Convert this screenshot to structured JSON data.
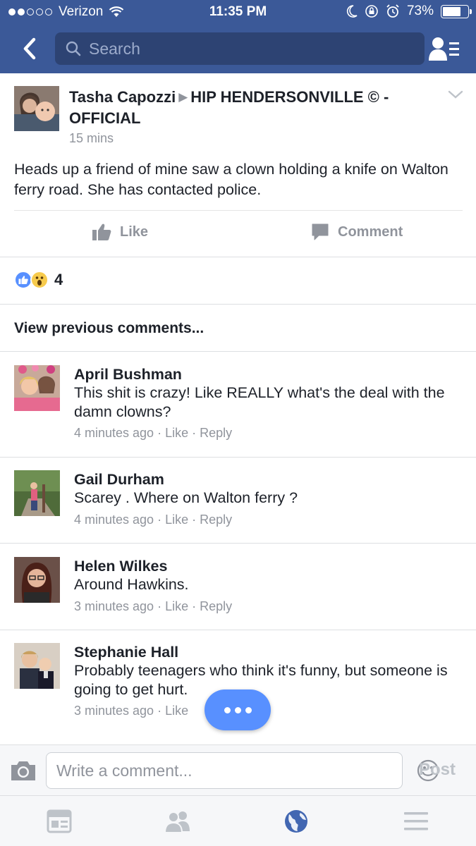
{
  "status_bar": {
    "carrier": "Verizon",
    "time": "11:35 PM",
    "battery": "73%",
    "battery_level": 0.73
  },
  "search": {
    "placeholder": "Search"
  },
  "post": {
    "author": "Tasha Capozzi",
    "group": "HIP HENDERSONVILLE © - OFFICIAL",
    "time": "15 mins",
    "text": "Heads up a friend of mine saw a clown holding a knife on Walton ferry road.  She has contacted police.",
    "like_label": "Like",
    "comment_label": "Comment",
    "reaction_count": "4"
  },
  "view_previous": "View previous comments...",
  "comments": [
    {
      "name": "April Bushman",
      "text": "This shit is crazy! Like REALLY what's the deal with the damn clowns?",
      "time": "4 minutes ago",
      "like": "Like",
      "reply": "Reply"
    },
    {
      "name": "Gail Durham",
      "text": "Scarey . Where on Walton ferry ?",
      "time": "4 minutes ago",
      "like": "Like",
      "reply": "Reply"
    },
    {
      "name": "Helen Wilkes",
      "text": "Around Hawkins.",
      "time": "3 minutes ago",
      "like": "Like",
      "reply": "Reply"
    },
    {
      "name": "Stephanie Hall",
      "text": "Probably teenagers who think it's funny, but someone is going to get hurt.",
      "time": "3 minutes ago",
      "like": "Like"
    }
  ],
  "composer": {
    "placeholder": "Write a comment...",
    "post_label": "Post"
  },
  "colors": {
    "brand": "#3b5998",
    "accent": "#5890ff",
    "muted": "#90949c"
  },
  "tabs": [
    "news-feed-icon",
    "friends-icon",
    "globe-icon",
    "menu-icon"
  ]
}
